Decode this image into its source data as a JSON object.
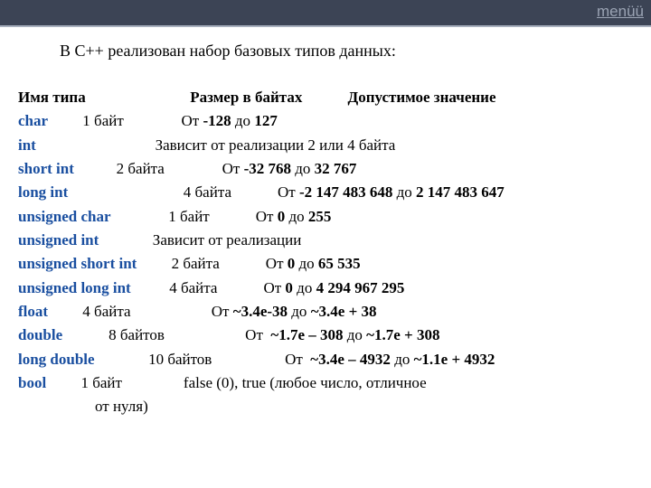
{
  "menu": {
    "label": "menüü"
  },
  "intro": "В С++ реализован набор базовых типов данных:",
  "header": {
    "c1": "Имя типа",
    "c2": "Размер в байтах",
    "c3": "Допустимое значение"
  },
  "rows": [
    {
      "kw": "char",
      "tail": "         1 байт               От <b>-128</b> до <b>127</b>"
    },
    {
      "kw": "int",
      "tail": "                               Зависит от реализации 2 или 4 байта"
    },
    {
      "kw": "short int",
      "tail": "           2 байта               От <b>-32 768</b> до <b>32 767</b>"
    },
    {
      "kw": "long int",
      "tail": "                              4 байта            От <b>-2 147 483 648</b> до <b>2 147 483 647</b>"
    },
    {
      "kw": "unsigned char",
      "tail": "               1 байт            От <b>0</b> до <b>255</b>"
    },
    {
      "kw": "unsigned int",
      "tail": "              Зависит от реализации"
    },
    {
      "kw": "unsigned short int",
      "tail": "         2 байта            От <b>0</b> до <b>65 535</b>"
    },
    {
      "kw": "unsigned long int",
      "tail": "          4 байта            От <b>0</b> до <b>4 294 967 295</b>"
    },
    {
      "kw": "float",
      "tail": "         4 байта                     От <b>~3.4e-38</b> до <b>~3.4e + 38</b>"
    },
    {
      "kw": "double",
      "tail": "            8 байтов                     От  <b>~1.7e – 308</b> до <b>~1.7e + 308</b>"
    },
    {
      "kw": "long double",
      "tail": "              10 байтов                   От  <b>~3.4e – 4932</b> до <b>~1.1e + 4932</b>"
    },
    {
      "kw": "bool",
      "tail": "         1 байт                false (0), true (любое число, отличное"
    }
  ],
  "trailing": "                    от нуля)"
}
